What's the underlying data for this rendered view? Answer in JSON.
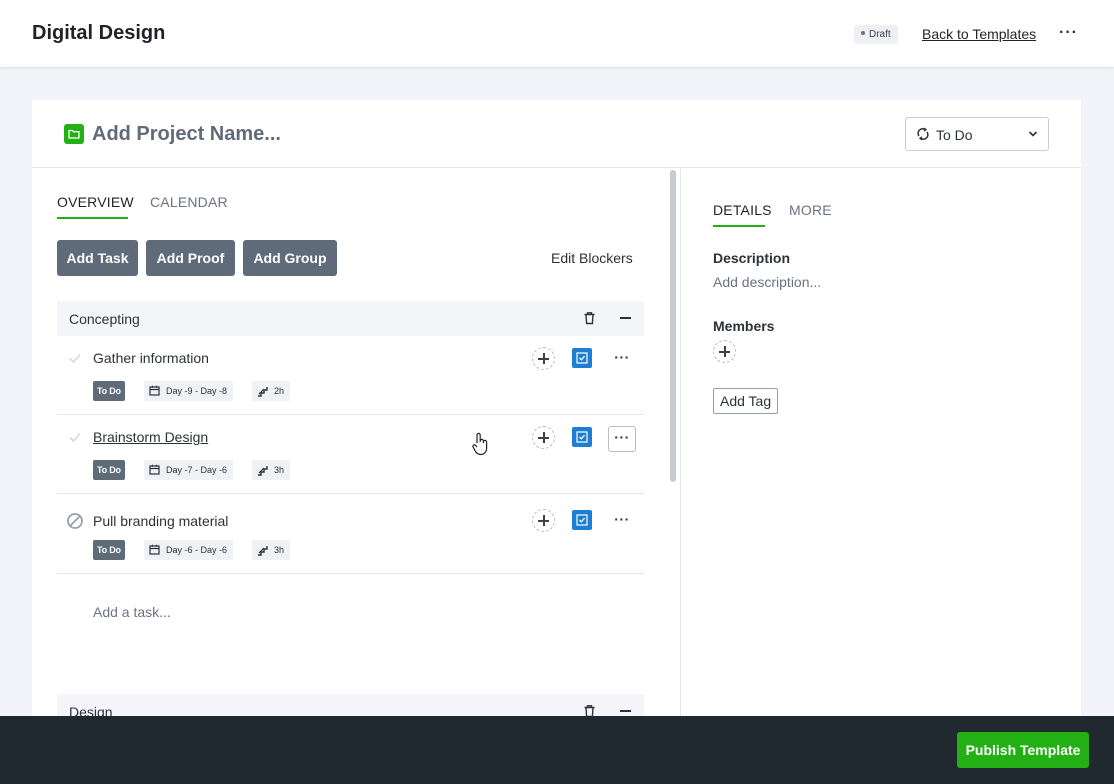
{
  "header": {
    "title": "Digital Design",
    "draft_badge": "Draft",
    "back_link": "Back to Templates",
    "more": "···"
  },
  "project": {
    "name_placeholder": "Add Project Name...",
    "status": "To Do",
    "folder_color": "#22b014"
  },
  "left_tabs": [
    {
      "label": "OVERVIEW",
      "active": true
    },
    {
      "label": "CALENDAR",
      "active": false
    }
  ],
  "toolbar": {
    "add_task": "Add Task",
    "add_proof": "Add Proof",
    "add_group": "Add Group",
    "edit_blockers": "Edit Blockers"
  },
  "groups": [
    {
      "name": "Concepting",
      "tasks": [
        {
          "name": "Gather information",
          "status": "To Do",
          "dates": "Day -9 - Day -8",
          "duration": "2h",
          "state": "check"
        },
        {
          "name": "Brainstorm Design",
          "status": "To Do",
          "dates": "Day -7 - Day -6",
          "duration": "3h",
          "state": "check"
        },
        {
          "name": "Pull branding material",
          "status": "To Do",
          "dates": "Day -6 - Day -6",
          "duration": "3h",
          "state": "blocked"
        }
      ],
      "add_task_placeholder": "Add a task..."
    },
    {
      "name": "Design",
      "tasks": []
    }
  ],
  "right_tabs": [
    {
      "label": "DETAILS",
      "active": true
    },
    {
      "label": "MORE",
      "active": false
    }
  ],
  "details": {
    "description_label": "Description",
    "description_placeholder": "Add description...",
    "members_label": "Members",
    "add_tag": "Add Tag"
  },
  "footer": {
    "publish": "Publish Template"
  },
  "colors": {
    "accent": "#22b014",
    "dark_button": "#5f6b78",
    "task_check": "#1d7fd4",
    "bottom_bar": "#1f292f"
  }
}
